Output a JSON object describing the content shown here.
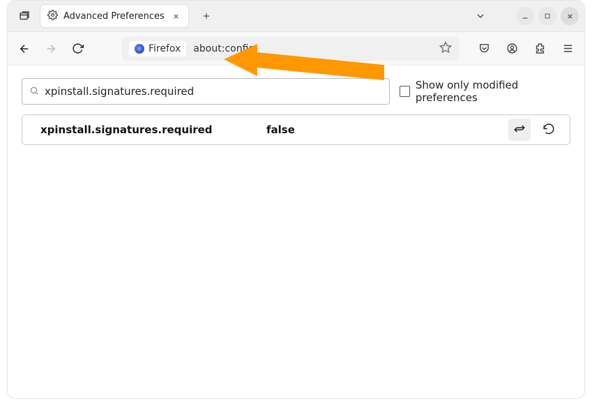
{
  "tab": {
    "title": "Advanced Preferences"
  },
  "urlbar": {
    "identity": "Firefox",
    "path": "about:config"
  },
  "search": {
    "value": "xpinstall.signatures.required"
  },
  "checkbox": {
    "label": "Show only modified preferences"
  },
  "pref": {
    "name": "xpinstall.signatures.required",
    "value": "false"
  }
}
